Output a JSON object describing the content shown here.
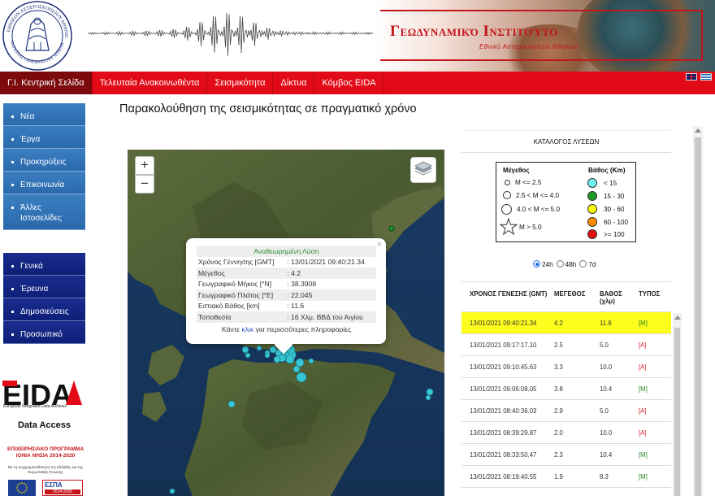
{
  "header": {
    "institute_title": "Γεωδυναμικό Ινστιτούτο",
    "institute_subtitle": "Εθνικό Αστεροσκοπείο Αθηνών",
    "logo_text_top": "ΕΘΝΙΚΟΝ ΑΣΤΕΡΟΣΚΟΠΕΙΟΝ ΑΘΗΝΩΝ",
    "logo_text_bottom": "NATIONAL OBSERVATORY ATHENS"
  },
  "nav": {
    "items": [
      {
        "label": "Γ.Ι. Κεντρική Σελίδα",
        "active": true
      },
      {
        "label": "Τελευταία Ανακοινωθέντα",
        "active": false
      },
      {
        "label": "Σεισμικότητα",
        "active": false
      },
      {
        "label": "Δίκτυα",
        "active": false
      },
      {
        "label": "Κόμβος EIDA",
        "active": false
      }
    ]
  },
  "sidebar": {
    "menu_a": [
      "Νέα",
      "Έργα",
      "Προκηρύξεις",
      "Επικοινωνία",
      "Άλλες Ιστοσελίδες"
    ],
    "menu_b": [
      "Γενικά",
      "Έρευνα",
      "Δημοσιεύσεις",
      "Προσωπικό"
    ],
    "eida_logo": "EIDA",
    "eida_subtitle": "European Integrated Data Archives",
    "data_access": "Data Access",
    "programme_line1": "ΕΠΙΧΕΙΡΗΣΙΑΚΟ ΠΡΟΓΡΑΜΜΑ",
    "programme_line2": "ΙΟΝΙΑ ΝΗΣΙΑ 2014-2020",
    "programme_note": "Με τη συγχρηματοδότηση της Ελλάδας και της Ευρωπαϊκής Ένωσης",
    "espa_text": "ΕΣΠΑ",
    "espa_years": "2014-2020"
  },
  "main": {
    "page_title": "Παρακολούθηση της σεισμικότητας σε πραγματικό χρόνο"
  },
  "map": {
    "zoom_in": "+",
    "zoom_out": "−",
    "popup": {
      "header": "Αναθεωρημένη Λύση",
      "rows": [
        {
          "label": "Χρόνος Γέννησης [GMT]",
          "value": ": 13/01/2021 09:40:21.34"
        },
        {
          "label": "Μέγεθος",
          "value": ": 4.2"
        },
        {
          "label": "Γεωγραφικό Μήκος [°N]",
          "value": ": 38.3908"
        },
        {
          "label": "Γεωγραφικό Πλάτος [°E]",
          "value": ": 22.045"
        },
        {
          "label": "Εστιακό Βάθος [km]",
          "value": ": 11.6"
        },
        {
          "label": "Τοποθεσία",
          "value": ": 16 Χλμ. ΒΒΔ του Αιγίου"
        }
      ],
      "more_prefix": "Κάντε ",
      "more_link": "κλικ",
      "more_suffix": " για περισσότερες πληροφορίες",
      "close": "×"
    }
  },
  "catalog": {
    "title": "ΚΑΤΑΛΟΓΟΣ ΛΥΣΕΩΝ",
    "legend": {
      "magnitude_header": "Μέγεθος",
      "depth_header": "Βάθος (Km)",
      "magnitudes": [
        "M <= 2.5",
        "2.5 < M <= 4.0",
        "4.0 < M <= 5.0",
        "M > 5.0"
      ],
      "depths": [
        {
          "label": "< 15",
          "color": "#6ff2f2"
        },
        {
          "label": "15 - 30",
          "color": "#1e9a2a"
        },
        {
          "label": "30 - 60",
          "color": "#ffff00"
        },
        {
          "label": "60 - 100",
          "color": "#ff8c00"
        },
        {
          "label": ">= 100",
          "color": "#e31010"
        }
      ]
    },
    "periods": [
      {
        "label": "24h",
        "checked": true
      },
      {
        "label": "48h",
        "checked": false
      },
      {
        "label": "7d",
        "checked": false
      }
    ],
    "columns": [
      "ΧΡΟΝΟΣ ΓΕΝΕΣΗΣ (GMT)",
      "ΜΕΓΕΘΟΣ",
      "ΒΑΘΟΣ (χλμ)",
      "ΤΥΠΟΣ"
    ],
    "events": [
      {
        "time": "13/01/2021 09:40:21.34",
        "mag": "4.2",
        "depth": "11.6",
        "type": "[M]",
        "highlight": true
      },
      {
        "time": "13/01/2021 09:17:17.10",
        "mag": "2.5",
        "depth": "5.0",
        "type": "[A]",
        "highlight": false
      },
      {
        "time": "13/01/2021 09:10:45.63",
        "mag": "3.3",
        "depth": "10.0",
        "type": "[A]",
        "highlight": false
      },
      {
        "time": "13/01/2021 09:06:08.05",
        "mag": "3.8",
        "depth": "10.4",
        "type": "[M]",
        "highlight": false
      },
      {
        "time": "13/01/2021 08:40:36.03",
        "mag": "2.9",
        "depth": "5.0",
        "type": "[A]",
        "highlight": false
      },
      {
        "time": "13/01/2021 08:39:29.87",
        "mag": "2.0",
        "depth": "10.0",
        "type": "[A]",
        "highlight": false
      },
      {
        "time": "13/01/2021 08:33:50.47",
        "mag": "2.3",
        "depth": "10.4",
        "type": "[M]",
        "highlight": false
      },
      {
        "time": "13/01/2021 08:19:40.55",
        "mag": "1.9",
        "depth": "8.3",
        "type": "[M]",
        "highlight": false
      }
    ]
  },
  "colors": {
    "nav_red": "#e30a17",
    "nav_active": "#7c0a0c",
    "highlight_row": "#fdfd1e",
    "event_marker": "#35c7d6"
  }
}
